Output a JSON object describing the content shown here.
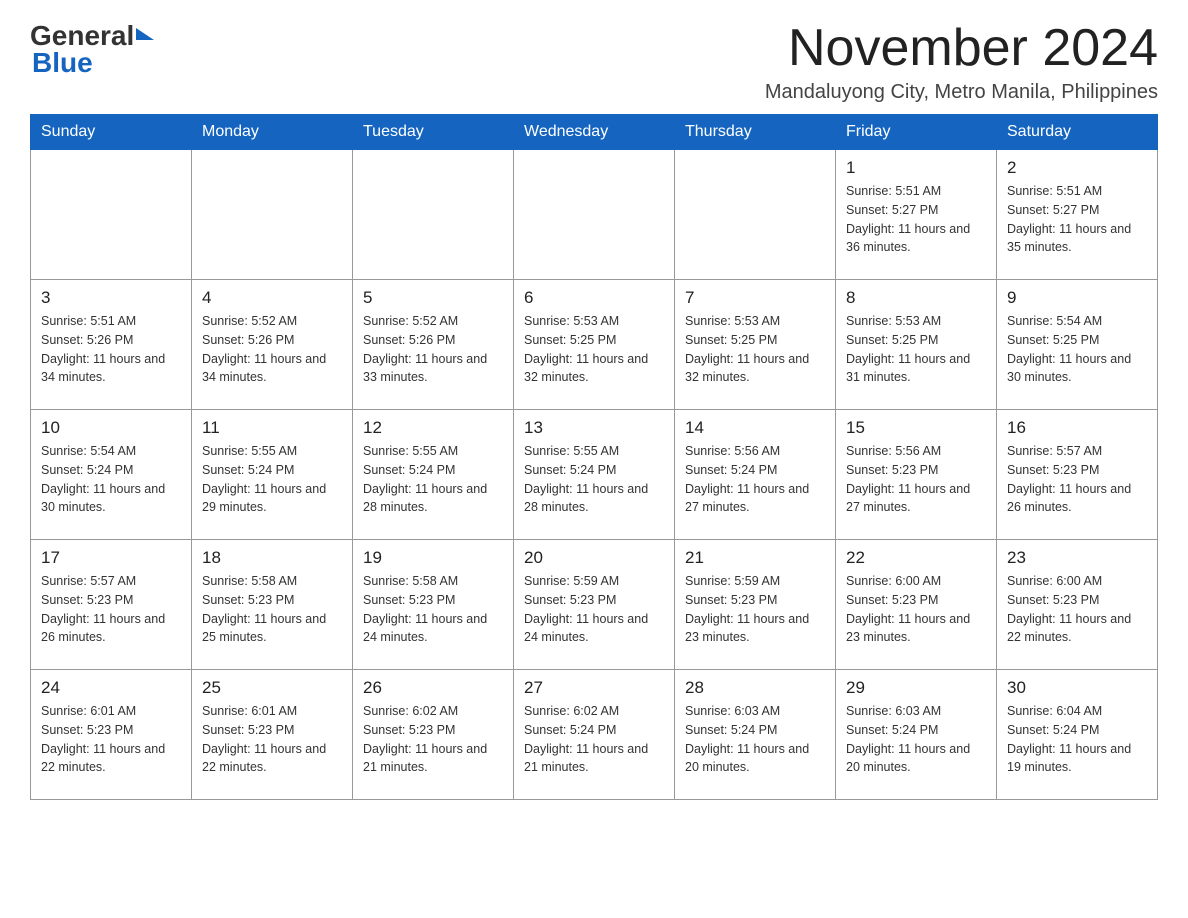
{
  "header": {
    "logo_general": "General",
    "logo_blue": "Blue",
    "month_title": "November 2024",
    "location": "Mandaluyong City, Metro Manila, Philippines"
  },
  "days_of_week": [
    "Sunday",
    "Monday",
    "Tuesday",
    "Wednesday",
    "Thursday",
    "Friday",
    "Saturday"
  ],
  "weeks": [
    [
      {
        "day": "",
        "info": ""
      },
      {
        "day": "",
        "info": ""
      },
      {
        "day": "",
        "info": ""
      },
      {
        "day": "",
        "info": ""
      },
      {
        "day": "",
        "info": ""
      },
      {
        "day": "1",
        "info": "Sunrise: 5:51 AM\nSunset: 5:27 PM\nDaylight: 11 hours and 36 minutes."
      },
      {
        "day": "2",
        "info": "Sunrise: 5:51 AM\nSunset: 5:27 PM\nDaylight: 11 hours and 35 minutes."
      }
    ],
    [
      {
        "day": "3",
        "info": "Sunrise: 5:51 AM\nSunset: 5:26 PM\nDaylight: 11 hours and 34 minutes."
      },
      {
        "day": "4",
        "info": "Sunrise: 5:52 AM\nSunset: 5:26 PM\nDaylight: 11 hours and 34 minutes."
      },
      {
        "day": "5",
        "info": "Sunrise: 5:52 AM\nSunset: 5:26 PM\nDaylight: 11 hours and 33 minutes."
      },
      {
        "day": "6",
        "info": "Sunrise: 5:53 AM\nSunset: 5:25 PM\nDaylight: 11 hours and 32 minutes."
      },
      {
        "day": "7",
        "info": "Sunrise: 5:53 AM\nSunset: 5:25 PM\nDaylight: 11 hours and 32 minutes."
      },
      {
        "day": "8",
        "info": "Sunrise: 5:53 AM\nSunset: 5:25 PM\nDaylight: 11 hours and 31 minutes."
      },
      {
        "day": "9",
        "info": "Sunrise: 5:54 AM\nSunset: 5:25 PM\nDaylight: 11 hours and 30 minutes."
      }
    ],
    [
      {
        "day": "10",
        "info": "Sunrise: 5:54 AM\nSunset: 5:24 PM\nDaylight: 11 hours and 30 minutes."
      },
      {
        "day": "11",
        "info": "Sunrise: 5:55 AM\nSunset: 5:24 PM\nDaylight: 11 hours and 29 minutes."
      },
      {
        "day": "12",
        "info": "Sunrise: 5:55 AM\nSunset: 5:24 PM\nDaylight: 11 hours and 28 minutes."
      },
      {
        "day": "13",
        "info": "Sunrise: 5:55 AM\nSunset: 5:24 PM\nDaylight: 11 hours and 28 minutes."
      },
      {
        "day": "14",
        "info": "Sunrise: 5:56 AM\nSunset: 5:24 PM\nDaylight: 11 hours and 27 minutes."
      },
      {
        "day": "15",
        "info": "Sunrise: 5:56 AM\nSunset: 5:23 PM\nDaylight: 11 hours and 27 minutes."
      },
      {
        "day": "16",
        "info": "Sunrise: 5:57 AM\nSunset: 5:23 PM\nDaylight: 11 hours and 26 minutes."
      }
    ],
    [
      {
        "day": "17",
        "info": "Sunrise: 5:57 AM\nSunset: 5:23 PM\nDaylight: 11 hours and 26 minutes."
      },
      {
        "day": "18",
        "info": "Sunrise: 5:58 AM\nSunset: 5:23 PM\nDaylight: 11 hours and 25 minutes."
      },
      {
        "day": "19",
        "info": "Sunrise: 5:58 AM\nSunset: 5:23 PM\nDaylight: 11 hours and 24 minutes."
      },
      {
        "day": "20",
        "info": "Sunrise: 5:59 AM\nSunset: 5:23 PM\nDaylight: 11 hours and 24 minutes."
      },
      {
        "day": "21",
        "info": "Sunrise: 5:59 AM\nSunset: 5:23 PM\nDaylight: 11 hours and 23 minutes."
      },
      {
        "day": "22",
        "info": "Sunrise: 6:00 AM\nSunset: 5:23 PM\nDaylight: 11 hours and 23 minutes."
      },
      {
        "day": "23",
        "info": "Sunrise: 6:00 AM\nSunset: 5:23 PM\nDaylight: 11 hours and 22 minutes."
      }
    ],
    [
      {
        "day": "24",
        "info": "Sunrise: 6:01 AM\nSunset: 5:23 PM\nDaylight: 11 hours and 22 minutes."
      },
      {
        "day": "25",
        "info": "Sunrise: 6:01 AM\nSunset: 5:23 PM\nDaylight: 11 hours and 22 minutes."
      },
      {
        "day": "26",
        "info": "Sunrise: 6:02 AM\nSunset: 5:23 PM\nDaylight: 11 hours and 21 minutes."
      },
      {
        "day": "27",
        "info": "Sunrise: 6:02 AM\nSunset: 5:24 PM\nDaylight: 11 hours and 21 minutes."
      },
      {
        "day": "28",
        "info": "Sunrise: 6:03 AM\nSunset: 5:24 PM\nDaylight: 11 hours and 20 minutes."
      },
      {
        "day": "29",
        "info": "Sunrise: 6:03 AM\nSunset: 5:24 PM\nDaylight: 11 hours and 20 minutes."
      },
      {
        "day": "30",
        "info": "Sunrise: 6:04 AM\nSunset: 5:24 PM\nDaylight: 11 hours and 19 minutes."
      }
    ]
  ]
}
